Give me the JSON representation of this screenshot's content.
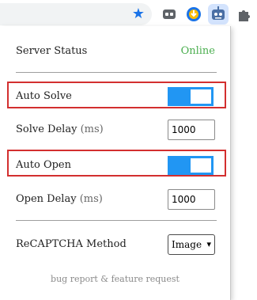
{
  "toolbar": {
    "bookmark_icon": "star-icon",
    "extensions": [
      "extension-icon",
      "download-icon",
      "robot-icon",
      "puzzle-icon"
    ]
  },
  "popup": {
    "server_status": {
      "label": "Server Status",
      "value": "Online",
      "value_color": "#4caf50"
    },
    "auto_solve": {
      "label": "Auto Solve",
      "enabled": true
    },
    "solve_delay": {
      "label": "Solve Delay",
      "unit": "(ms)",
      "value": "1000"
    },
    "auto_open": {
      "label": "Auto Open",
      "enabled": true
    },
    "open_delay": {
      "label": "Open Delay",
      "unit": "(ms)",
      "value": "1000"
    },
    "recaptcha_method": {
      "label": "ReCAPTCHA Method",
      "selected": "Image"
    },
    "footer_link": "bug report & feature request"
  },
  "colors": {
    "accent": "#2196f3",
    "highlight": "#d32f2f"
  }
}
